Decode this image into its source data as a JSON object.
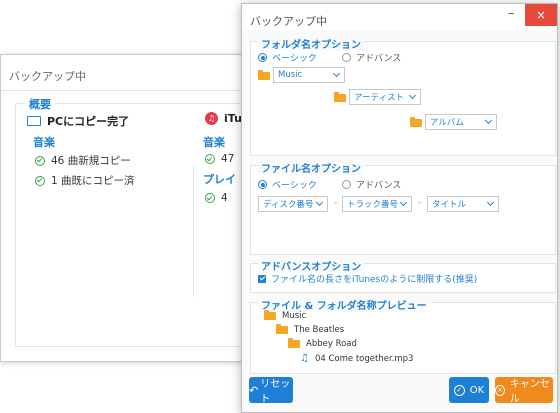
{
  "background_window": {
    "title": "バックアップ中",
    "summary_label": "概要",
    "pc_label": "PCにコピー完了",
    "itunes_label": "iTu",
    "music_label_left": "音楽",
    "rows_left": [
      "46 曲新規コピー",
      "1 曲既にコピー済"
    ],
    "music_label_right": "音楽",
    "playlist_label": "プレイ",
    "rows_right": [
      "47",
      "4"
    ]
  },
  "dialog": {
    "title": "バックアップ中",
    "minimize": "–",
    "close": "×",
    "folder_options": {
      "legend": "フォルダ名オプション",
      "basic": "ベーシック",
      "advanced": "アドバンス",
      "basic_selected": true,
      "dropdowns": [
        "Music",
        "アーティスト",
        "アルバム"
      ]
    },
    "file_options": {
      "legend": "ファイル名オプション",
      "basic": "ベーシック",
      "advanced": "アドバンス",
      "basic_selected": true,
      "dropdowns": [
        "ディスク番号",
        "トラック番号",
        "タイトル"
      ],
      "separators": [
        "-",
        "-"
      ]
    },
    "advanced_options": {
      "legend": "アドバンスオプション",
      "checkbox_label": "ファイル名の長さをiTunesのように制限する(推奨)",
      "checked": true
    },
    "preview": {
      "legend": "ファイル & フォルダ名称プレビュー",
      "items": [
        "Music",
        "The Beatles",
        "Abbey Road",
        "04 Come together.mp3"
      ]
    },
    "buttons": {
      "reset": "リセット",
      "ok": "OK",
      "cancel": "キャンセル"
    },
    "colors": {
      "accent": "#1e7fd6",
      "close": "#e64a3b",
      "cancel": "#f08a1c",
      "folder": "#f5a623"
    }
  }
}
